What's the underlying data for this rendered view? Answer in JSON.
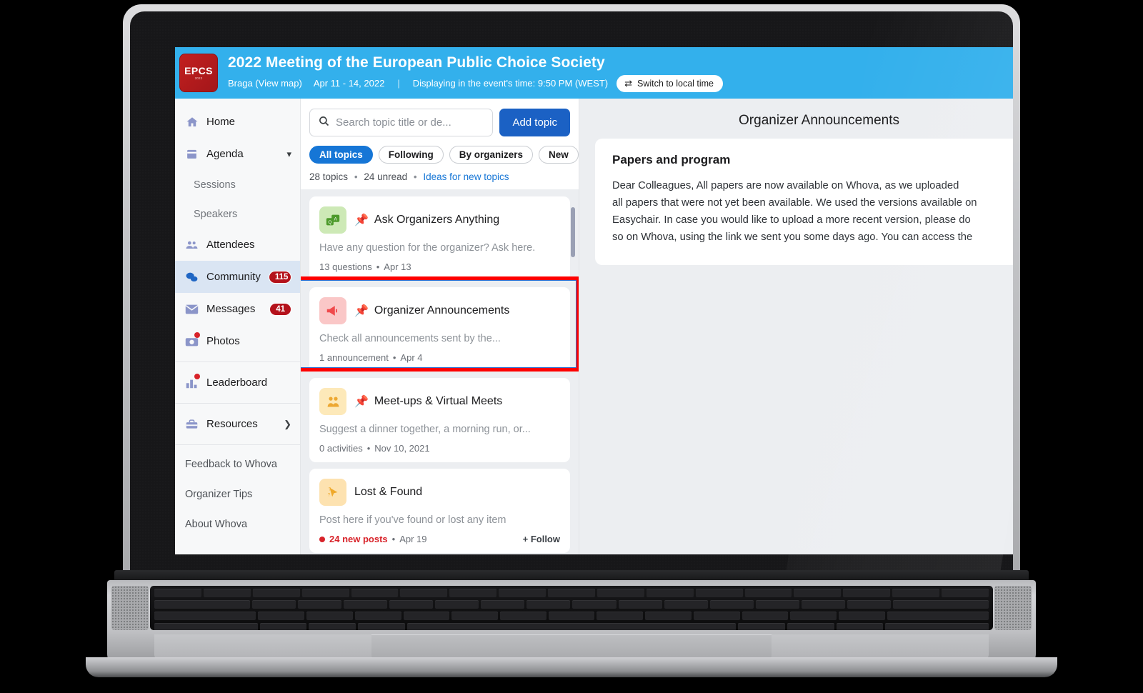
{
  "header": {
    "logo_main": "EPCS",
    "logo_year": "2022",
    "title": "2022 Meeting of the European Public Choice Society",
    "location": "Braga (View map)",
    "dates": "Apr 11 - 14, 2022",
    "divider": "|",
    "timezone_text": "Displaying in the event's time: 9:50 PM (WEST)",
    "switch_button": "Switch to local time",
    "switch_icon": "swap-arrows-icon",
    "accent_color": "#33b0ec"
  },
  "sidebar": {
    "items": [
      {
        "label": "Home",
        "icon": "home-icon"
      },
      {
        "label": "Agenda",
        "icon": "calendar-icon",
        "chevron": "chevron-down-icon"
      },
      {
        "label": "Sessions",
        "sub": true
      },
      {
        "label": "Speakers",
        "sub": true
      },
      {
        "label": "Attendees",
        "icon": "people-icon"
      },
      {
        "label": "Community",
        "icon": "chat-bubbles-icon",
        "badge": "115",
        "active": true
      },
      {
        "label": "Messages",
        "icon": "envelope-icon",
        "badge": "41"
      },
      {
        "label": "Photos",
        "icon": "camera-icon",
        "dot": true
      }
    ],
    "leaderboard": {
      "label": "Leaderboard",
      "icon": "bar-chart-icon",
      "dot": true
    },
    "resources": {
      "label": "Resources",
      "icon": "toolbox-icon",
      "chevron": "chevron-right-icon"
    },
    "links": [
      {
        "label": "Feedback to Whova"
      },
      {
        "label": "Organizer Tips"
      },
      {
        "label": "About Whova"
      }
    ],
    "badge_color": "#b4121b",
    "active_bg": "#dae5f3"
  },
  "topics": {
    "search_placeholder": "Search topic title or de...",
    "search_value": "",
    "search_icon": "search-icon",
    "add_button": "Add topic",
    "filters": [
      {
        "label": "All topics",
        "selected": true
      },
      {
        "label": "Following",
        "selected": false
      },
      {
        "label": "By organizers",
        "selected": false
      },
      {
        "label": "New",
        "selected": false
      }
    ],
    "count_text": "28 topics",
    "unread_text": "24 unread",
    "ideas_link": "Ideas for new topics",
    "cards": [
      {
        "icon": "qa-bubbles-icon",
        "icon_glyph": "❔",
        "icon_color": "green",
        "pinned": true,
        "title": "Ask Organizers Anything",
        "desc": "Have any question for the organizer? Ask here.",
        "count": "13 questions",
        "date": "Apr 13",
        "highlighted": false
      },
      {
        "icon": "megaphone-icon",
        "icon_glyph": "📣",
        "icon_color": "pink",
        "pinned": true,
        "title": "Organizer Announcements",
        "desc": "Check all announcements sent by the...",
        "count": "1 announcement",
        "date": "Apr 4",
        "highlighted": true
      },
      {
        "icon": "meetup-people-icon",
        "icon_glyph": "👥",
        "icon_color": "yellow",
        "pinned": true,
        "title": "Meet-ups & Virtual Meets",
        "desc": "Suggest a dinner together, a morning run, or...",
        "count": "0 activities",
        "date": "Nov 10, 2021",
        "highlighted": false
      },
      {
        "icon": "lost-found-cursor-icon",
        "icon_glyph": "➤",
        "icon_color": "yellow2",
        "pinned": false,
        "title": "Lost & Found",
        "desc": "Post here if you've found or lost any item",
        "count": "24 new posts",
        "date": "Apr 19",
        "follow": "+ Follow",
        "new_posts": true,
        "highlighted": false
      }
    ],
    "highlight_color": "#fe0000"
  },
  "detail": {
    "title": "Organizer Announcements",
    "announcement_title": "Papers and program",
    "announcement_lines": [
      "Dear Colleagues, All papers are now available on Whova, as we uploaded",
      "all papers that were not yet been available. We used the versions available on",
      "Easychair. In case you would like to upload a more recent version, please do",
      "so on Whova, using the link we sent you some days ago. You can access the"
    ]
  }
}
